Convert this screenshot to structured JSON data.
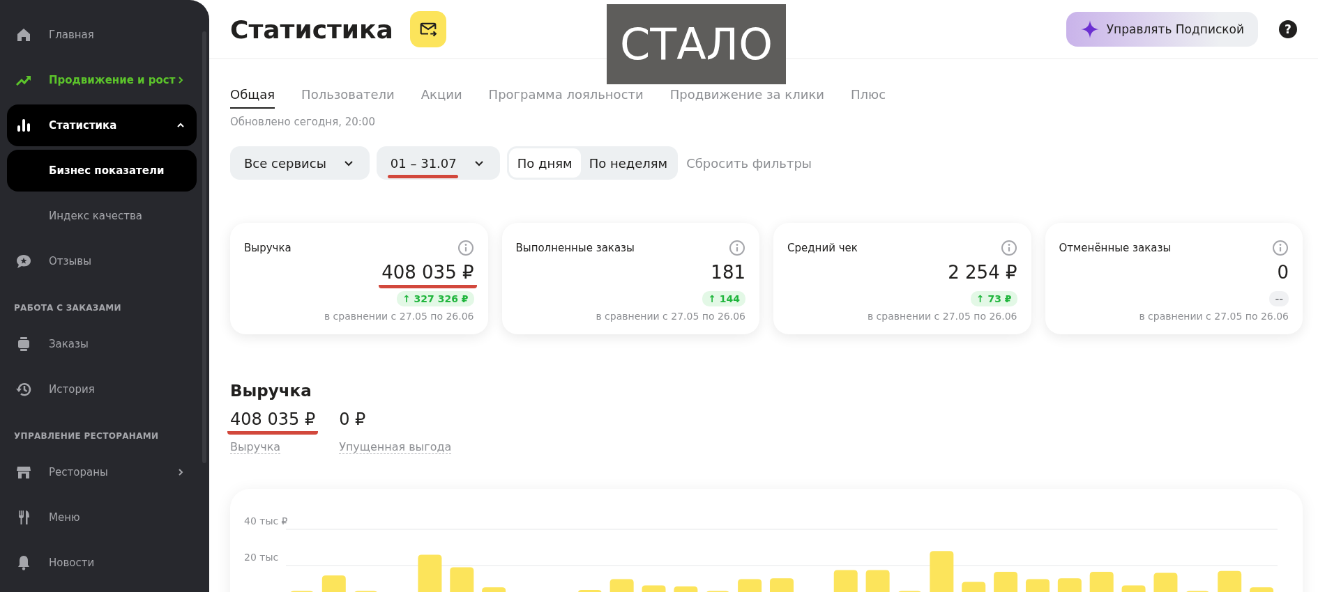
{
  "sidebar": {
    "items": [
      {
        "kind": "nav",
        "label": "Главная",
        "selected": false,
        "accent": false
      },
      {
        "kind": "nav",
        "label": "Продвижение и рост",
        "selected": false,
        "accent": true,
        "expanded": false
      },
      {
        "kind": "nav",
        "label": "Статистика",
        "selected": true,
        "accent": false,
        "expanded": true
      },
      {
        "kind": "sub",
        "label": "Бизнес показатели",
        "selected": true
      },
      {
        "kind": "sub",
        "label": "Индекс качества",
        "selected": false
      },
      {
        "kind": "nav",
        "label": "Отзывы",
        "selected": false,
        "accent": false
      },
      {
        "kind": "header",
        "label": "РАБОТА С ЗАКАЗАМИ"
      },
      {
        "kind": "nav",
        "label": "Заказы",
        "selected": false,
        "accent": false
      },
      {
        "kind": "nav",
        "label": "История",
        "selected": false,
        "accent": false
      },
      {
        "kind": "header",
        "label": "УПРАВЛЕНИЕ РЕСТОРАНАМИ"
      },
      {
        "kind": "nav",
        "label": "Рестораны",
        "selected": false,
        "accent": false,
        "expanded": false
      },
      {
        "kind": "nav",
        "label": "Меню",
        "selected": false,
        "accent": false
      },
      {
        "kind": "nav",
        "label": "Новости",
        "selected": false,
        "accent": false
      }
    ]
  },
  "header": {
    "title": "Статистика",
    "subscription_button": "Управлять Подпиской",
    "help": "?"
  },
  "annotation": {
    "label": "СТАЛО"
  },
  "tabs": [
    {
      "label": "Общая",
      "selected": true
    },
    {
      "label": "Пользователи",
      "selected": false
    },
    {
      "label": "Акции",
      "selected": false
    },
    {
      "label": "Программа лояльности",
      "selected": false
    },
    {
      "label": "Продвижение за клики",
      "selected": false
    },
    {
      "label": "Плюс",
      "selected": false
    }
  ],
  "updated": "Обновлено сегодня, 20:00",
  "filters": {
    "dropdowns": [
      {
        "label": "Все сервисы",
        "highlighted": false
      },
      {
        "label": "01 – 31.07",
        "highlighted": true
      }
    ],
    "period": [
      {
        "label": "По дням",
        "selected": true
      },
      {
        "label": "По неделям",
        "selected": false
      }
    ],
    "reset": "Сбросить фильтры"
  },
  "cards": [
    {
      "title": "Выручка",
      "value": "408 035 ₽",
      "delta": "↑ 327 326 ₽",
      "positive": true,
      "comparison": "в сравнении с 27.05 по 26.06",
      "highlighted": true
    },
    {
      "title": "Выполненные заказы",
      "value": "181",
      "delta": "↑ 144",
      "positive": true,
      "comparison": "в сравнении с 27.05 по 26.06",
      "highlighted": false
    },
    {
      "title": "Средний чек",
      "value": "2 254 ₽",
      "delta": "↑ 73 ₽",
      "positive": true,
      "comparison": "в сравнении с 27.05 по 26.06",
      "highlighted": false
    },
    {
      "title": "Отменённые заказы",
      "value": "0",
      "delta": "--",
      "positive": false,
      "comparison": "в сравнении с 27.05 по 26.06",
      "highlighted": false
    }
  ],
  "revenue": {
    "title": "Выручка",
    "metrics": [
      {
        "value": "408 035 ₽",
        "label": "Выручка",
        "highlighted": true
      },
      {
        "value": "0 ₽",
        "label": "Упущенная выгода",
        "highlighted": false
      }
    ],
    "chart_data": {
      "type": "bar",
      "ylim": [
        0,
        40
      ],
      "yticks": [
        {
          "value": 20,
          "label": "20 тыс"
        },
        {
          "value": 40,
          "label": "40 тыс ₽"
        }
      ],
      "values": [
        6,
        14.5,
        6,
        0,
        26,
        19,
        8,
        0,
        0,
        6.5,
        12.5,
        9,
        8.5,
        6,
        12.5,
        13,
        0,
        17.5,
        17.5,
        6,
        28,
        11,
        16.5,
        12.5,
        13,
        16.5,
        9,
        16,
        6,
        17,
        8
      ]
    }
  }
}
